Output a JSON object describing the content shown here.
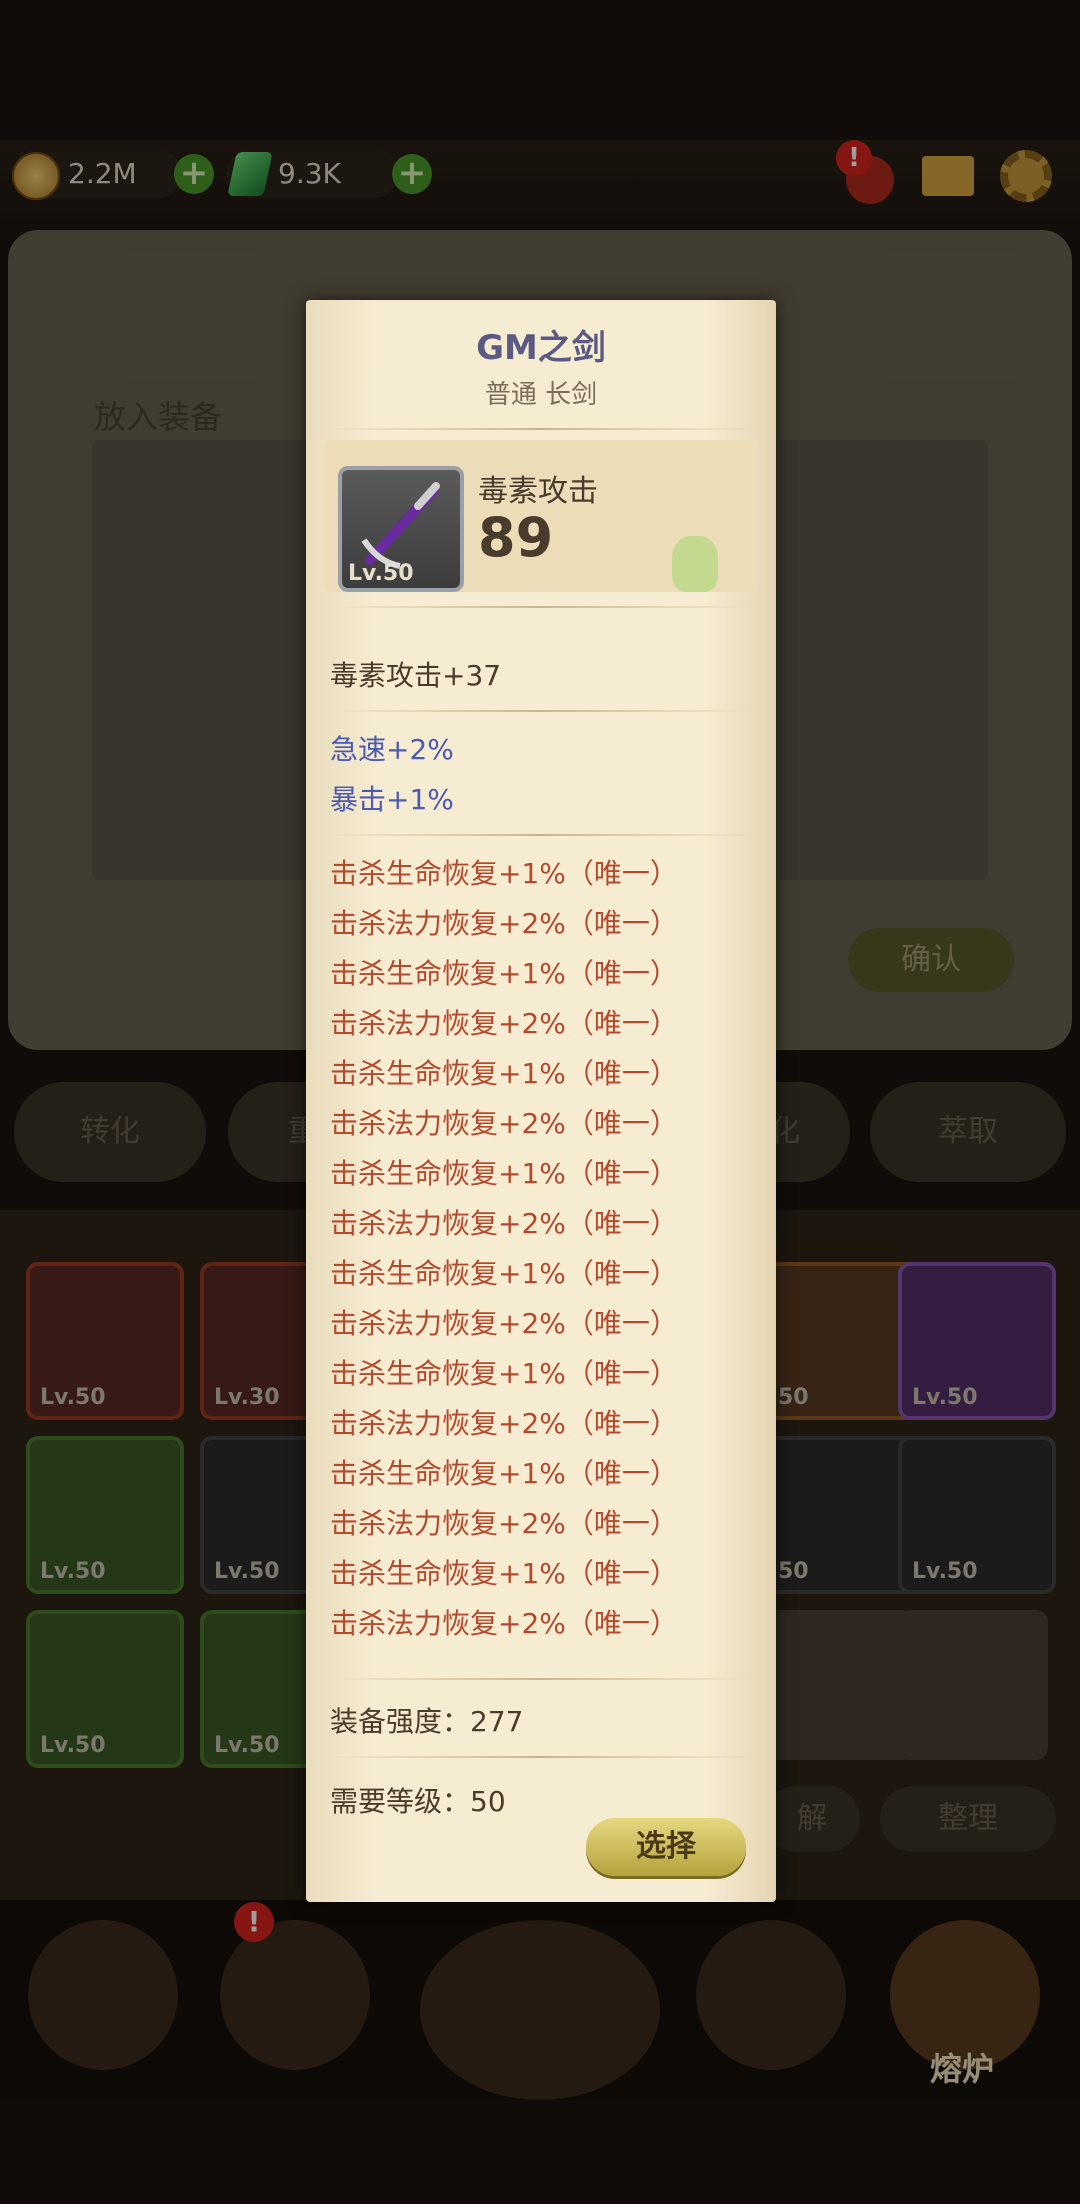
{
  "resources": {
    "gold": "2.2M",
    "gems": "9.3K"
  },
  "bg": {
    "panel_title": "放入装备",
    "confirm": "确认",
    "tabs": [
      "转化",
      "萃取"
    ],
    "tab_partial_1": "重",
    "tab_partial_2": "化",
    "slots": [
      "Lv.50",
      "Lv.30",
      "50",
      "Lv.50",
      "Lv.50",
      "Lv.50",
      "50",
      "Lv.50",
      "Lv.50",
      "Lv.50"
    ],
    "action_partial": "解",
    "sort": "整理",
    "nav_furnace": "熔炉"
  },
  "tooltip": {
    "name": "GM之剑",
    "subtitle": "普通 长剑",
    "level_badge": "Lv.50",
    "main_stat_label": "毒素攻击",
    "main_stat_value": "89",
    "base_bonus": "毒素攻击+37",
    "blue_stats": [
      "急速+2%",
      "暴击+1%"
    ],
    "affixes": [
      "击杀生命恢复+1%（唯一）",
      "击杀法力恢复+2%（唯一）",
      "击杀生命恢复+1%（唯一）",
      "击杀法力恢复+2%（唯一）",
      "击杀生命恢复+1%（唯一）",
      "击杀法力恢复+2%（唯一）",
      "击杀生命恢复+1%（唯一）",
      "击杀法力恢复+2%（唯一）",
      "击杀生命恢复+1%（唯一）",
      "击杀法力恢复+2%（唯一）",
      "击杀生命恢复+1%（唯一）",
      "击杀法力恢复+2%（唯一）",
      "击杀生命恢复+1%（唯一）",
      "击杀法力恢复+2%（唯一）",
      "击杀生命恢复+1%（唯一）",
      "击杀法力恢复+2%（唯一）"
    ],
    "strength": "装备强度：277",
    "required_level": "需要等级：50",
    "select_button": "选择"
  }
}
